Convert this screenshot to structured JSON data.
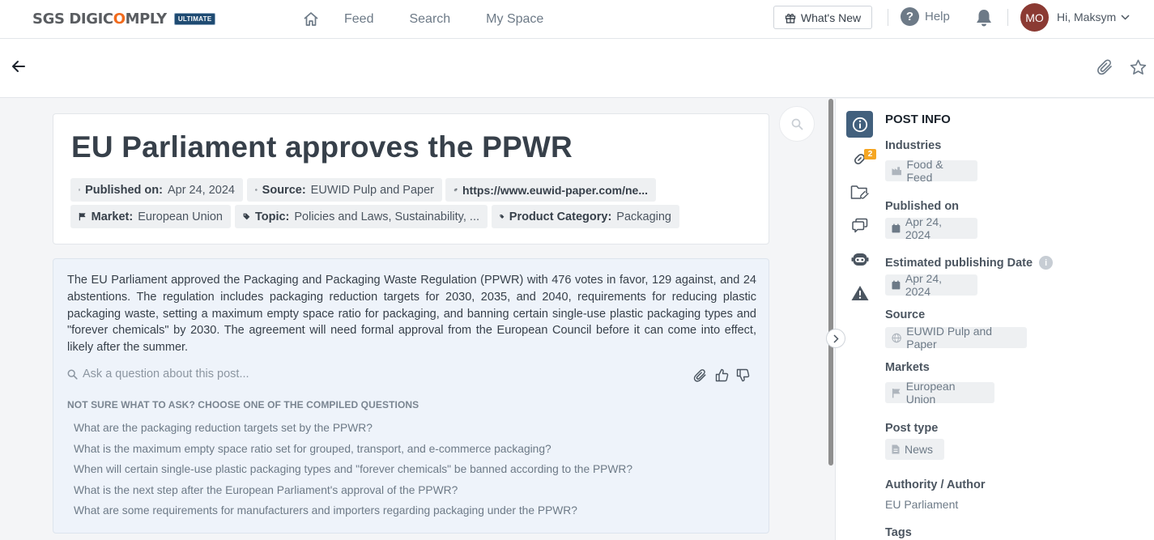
{
  "header": {
    "logo_text_a": "SGS DIGIC",
    "logo_text_o": "O",
    "logo_text_b": "MPLY",
    "logo_badge": "ULTIMATE",
    "nav": [
      "Feed",
      "Search",
      "My Space"
    ],
    "whats_new": "What's New",
    "help": "Help",
    "avatar_initials": "MO",
    "greeting": "Hi, Maksym"
  },
  "post": {
    "title": "EU Parliament approves the PPWR",
    "published_label": "Published on:",
    "published_value": "Apr 24, 2024",
    "source_label": "Source:",
    "source_value": "EUWID Pulp and Paper",
    "link": "https://www.euwid-paper.com/ne...",
    "market_label": "Market:",
    "market_value": "European Union",
    "topic_label": "Topic:",
    "topic_value": "Policies and Laws, Sustainability, ...",
    "category_label": "Product Category:",
    "category_value": "Packaging"
  },
  "summary": {
    "text": "The EU Parliament approved the Packaging and Packaging Waste Regulation (PPWR) with 476 votes in favor, 129 against, and 24 abstentions. The regulation includes packaging reduction targets for 2030, 2035, and 2040, requirements for reducing plastic packaging waste, setting a maximum empty space ratio for packaging, and banning certain single-use plastic packaging types and \"forever chemicals\" by 2030. The agreement will need formal approval from the European Council before it can come into effect, likely after the summer.",
    "ask_placeholder": "Ask a question about this post...",
    "questions_heading": "NOT SURE WHAT TO ASK? CHOOSE ONE OF THE COMPILED QUESTIONS",
    "questions": [
      "What are the packaging reduction targets set by the PPWR?",
      "What is the maximum empty space ratio set for grouped, transport, and e-commerce packaging?",
      "When will certain single-use plastic packaging types and \"forever chemicals\" be banned according to the PPWR?",
      "What is the next step after the European Parliament's approval of the PPWR?",
      "What are some requirements for manufacturers and importers regarding packaging under the PPWR?"
    ]
  },
  "post_info": {
    "title": "POST INFO",
    "links_badge": "2",
    "industries_label": "Industries",
    "industries_value": "Food & Feed",
    "published_label": "Published on",
    "published_value": "Apr 24, 2024",
    "est_label": "Estimated publishing Date",
    "est_value": "Apr 24, 2024",
    "source_label": "Source",
    "source_value": "EUWID Pulp and Paper",
    "markets_label": "Markets",
    "markets_value": "European Union",
    "post_type_label": "Post type",
    "post_type_value": "News",
    "author_label": "Authority / Author",
    "author_value": "EU Parliament",
    "tags_label": "Tags"
  },
  "colors": {
    "accent": "#42607d",
    "brand_orange": "#f26b1d",
    "badge": "#f5a623",
    "avatar": "#8b3a33"
  }
}
